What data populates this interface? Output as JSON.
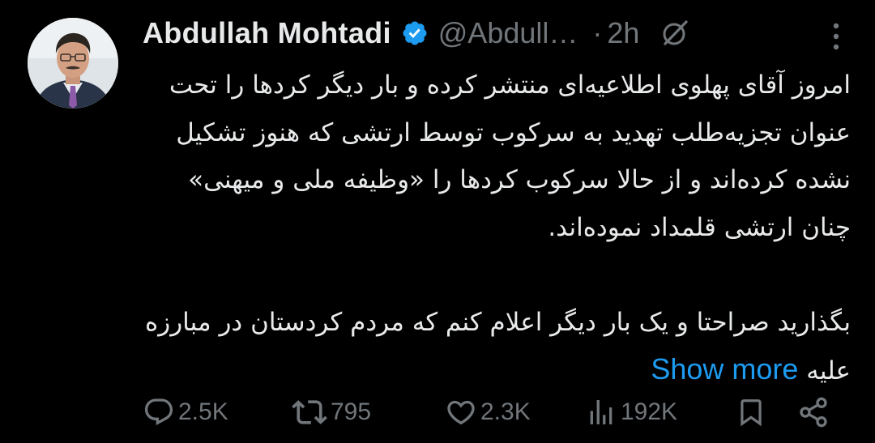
{
  "author": {
    "display_name": "Abdullah Mohtadi",
    "handle": "@Abdull…",
    "separator": "·",
    "time": "2h",
    "verified_badge_color": "#1d9bf0"
  },
  "tweet": {
    "paragraph_1": "امروز آقای پهلوی اطلاعیه‌ای منتشر کرده و بار دیگر کردها را تحت عنوان تجزیه‌طلب تهدید به سرکوب توسط ارتشی که هنوز تشکیل نشده کرده‌اند و از حالا سرکوب کردها را «وظیفه ملی و میهنی» چنان ارتشی قلمداد نموده‌اند.",
    "paragraph_2": "بگذارید صراحتا و یک بار دیگر اعلام کنم که مردم کردستان در مبارزه علیه",
    "show_more": "Show more"
  },
  "actions": {
    "replies": "2.5K",
    "reposts": "795",
    "likes": "2.3K",
    "views": "192K"
  },
  "icons": {
    "avatar": "profile-photo",
    "verified": "verified-badge-icon",
    "grok": "grok-icon",
    "more": "more-options-icon",
    "reply": "reply-icon",
    "repost": "repost-icon",
    "like": "heart-icon",
    "views": "views-icon",
    "bookmark": "bookmark-icon",
    "share": "share-icon"
  },
  "colors": {
    "background": "#000000",
    "text_primary": "#e7e9ea",
    "text_secondary": "#71767b",
    "link": "#1d9bf0"
  }
}
